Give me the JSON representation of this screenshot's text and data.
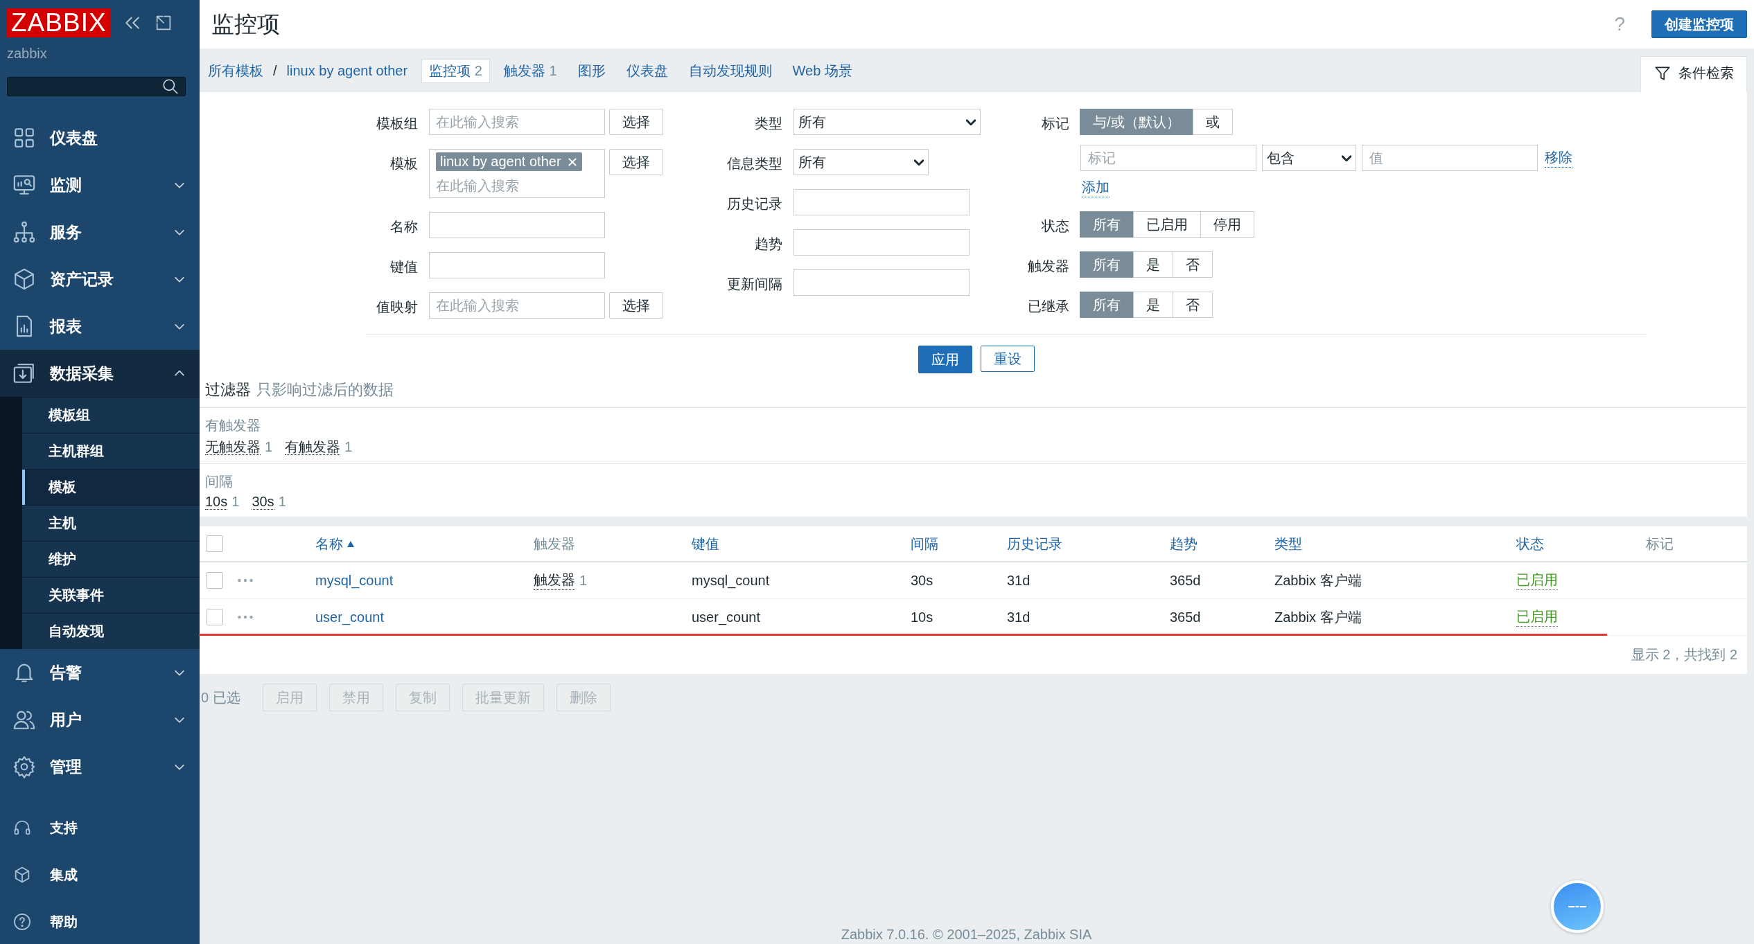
{
  "sidebar": {
    "logo": "ZABBIX",
    "server": "zabbix",
    "menu": [
      {
        "label": "仪表盘",
        "expandable": false,
        "expanded": false
      },
      {
        "label": "监测",
        "expandable": true,
        "expanded": false
      },
      {
        "label": "服务",
        "expandable": true,
        "expanded": false
      },
      {
        "label": "资产记录",
        "expandable": true,
        "expanded": false
      },
      {
        "label": "报表",
        "expandable": true,
        "expanded": false
      },
      {
        "label": "数据采集",
        "expandable": true,
        "expanded": true,
        "children": [
          {
            "label": "模板组",
            "selected": false
          },
          {
            "label": "主机群组",
            "selected": false
          },
          {
            "label": "模板",
            "selected": true
          },
          {
            "label": "主机",
            "selected": false
          },
          {
            "label": "维护",
            "selected": false
          },
          {
            "label": "关联事件",
            "selected": false
          },
          {
            "label": "自动发现",
            "selected": false
          }
        ]
      },
      {
        "label": "告警",
        "expandable": true,
        "expanded": false
      },
      {
        "label": "用户",
        "expandable": true,
        "expanded": false
      },
      {
        "label": "管理",
        "expandable": true,
        "expanded": false
      }
    ],
    "footer_menu": [
      {
        "label": "支持"
      },
      {
        "label": "集成"
      },
      {
        "label": "帮助"
      }
    ]
  },
  "header": {
    "title": "监控项",
    "help": "?",
    "create_button": "创建监控项"
  },
  "nav": {
    "breadcrumb": [
      {
        "label": "所有模板"
      },
      {
        "label": "linux by agent other"
      }
    ],
    "separator": "/",
    "tabs": [
      {
        "label": "监控项",
        "count": "2",
        "selected": true
      },
      {
        "label": "触发器",
        "count": "1",
        "selected": false
      },
      {
        "label": "图形",
        "selected": false
      },
      {
        "label": "仪表盘",
        "selected": false
      },
      {
        "label": "自动发现规则",
        "selected": false
      },
      {
        "label": "Web 场景",
        "selected": false
      }
    ],
    "filter_tab": {
      "label": "条件检索",
      "selected": true
    }
  },
  "filter": {
    "columns": [
      [
        {
          "label": "模板组",
          "kind": "multiselect",
          "placeholder": "在此输入搜索",
          "button": "选择"
        },
        {
          "label": "模板",
          "kind": "multiselect",
          "chips": [
            "linux by agent other"
          ],
          "placeholder": "在此输入搜索",
          "button": "选择"
        },
        {
          "label": "名称",
          "kind": "text"
        },
        {
          "label": "键值",
          "kind": "text"
        },
        {
          "label": "值映射",
          "kind": "multiselect",
          "placeholder": "在此输入搜索",
          "button": "选择"
        }
      ],
      [
        {
          "label": "类型",
          "kind": "select",
          "value": "所有"
        },
        {
          "label": "信息类型",
          "kind": "select",
          "value": "所有"
        },
        {
          "label": "历史记录",
          "kind": "text"
        },
        {
          "label": "趋势",
          "kind": "text"
        },
        {
          "label": "更新间隔",
          "kind": "text"
        }
      ],
      [
        {
          "label": "标记",
          "kind": "tags",
          "options": [
            {
              "label": "与/或（默认）",
              "selected": true
            },
            {
              "label": "或",
              "selected": false
            }
          ],
          "tag_placeholder": "标记",
          "operator": "包含",
          "value_placeholder": "值",
          "remove": "移除",
          "add": "添加"
        },
        {
          "label": "状态",
          "kind": "radio",
          "options": [
            {
              "label": "所有",
              "selected": true
            },
            {
              "label": "已启用",
              "selected": false
            },
            {
              "label": "停用",
              "selected": false
            }
          ]
        },
        {
          "label": "触发器",
          "kind": "radio",
          "options": [
            {
              "label": "所有",
              "selected": true
            },
            {
              "label": "是",
              "selected": false
            },
            {
              "label": "否",
              "selected": false
            }
          ]
        },
        {
          "label": "已继承",
          "kind": "radio",
          "options": [
            {
              "label": "所有",
              "selected": true
            },
            {
              "label": "是",
              "selected": false
            },
            {
              "label": "否",
              "selected": false
            }
          ]
        }
      ]
    ],
    "apply": "应用",
    "reset": "重设"
  },
  "subfilter": {
    "title": "过滤器",
    "note": "只影响过滤后的数据",
    "groups": [
      {
        "title": "有触发器",
        "items": [
          {
            "label": "无触发器",
            "count": "1"
          },
          {
            "label": "有触发器",
            "count": "1"
          }
        ]
      },
      {
        "title": "间隔",
        "items": [
          {
            "label": "10s",
            "count": "1"
          },
          {
            "label": "30s",
            "count": "1"
          }
        ]
      }
    ]
  },
  "table": {
    "select_all_checked": false,
    "columns": [
      {
        "label": "名称",
        "sortable": true,
        "sorted": true
      },
      {
        "label": "触发器",
        "sortable": false,
        "sorted": false
      },
      {
        "label": "键值",
        "sortable": true,
        "sorted": false
      },
      {
        "label": "间隔",
        "sortable": true,
        "sorted": false
      },
      {
        "label": "历史记录",
        "sortable": true,
        "sorted": false
      },
      {
        "label": "趋势",
        "sortable": true,
        "sorted": false
      },
      {
        "label": "类型",
        "sortable": true,
        "sorted": false
      },
      {
        "label": "状态",
        "sortable": true,
        "sorted": false
      },
      {
        "label": "标记",
        "sortable": false,
        "sorted": false
      }
    ],
    "rows": [
      {
        "checked": false,
        "name": "mysql_count",
        "triggers": "触发器",
        "trigger_count": "1",
        "key": "mysql_count",
        "interval": "30s",
        "history": "31d",
        "trends": "365d",
        "type": "Zabbix 客户端",
        "status": "已启用",
        "enabled": true
      },
      {
        "checked": false,
        "name": "user_count",
        "key": "user_count",
        "interval": "10s",
        "history": "31d",
        "trends": "365d",
        "type": "Zabbix 客户端",
        "status": "已启用",
        "enabled": true
      }
    ],
    "summary": "显示 2，共找到 2"
  },
  "actions": {
    "selected": "0 已选",
    "buttons": [
      {
        "label": "启用",
        "disabled": true
      },
      {
        "label": "禁用",
        "disabled": true
      },
      {
        "label": "复制",
        "disabled": true
      },
      {
        "label": "批量更新",
        "disabled": true
      },
      {
        "label": "删除",
        "disabled": true
      }
    ]
  },
  "footer": "Zabbix 7.0.16. © 2001–2025, Zabbix SIA"
}
